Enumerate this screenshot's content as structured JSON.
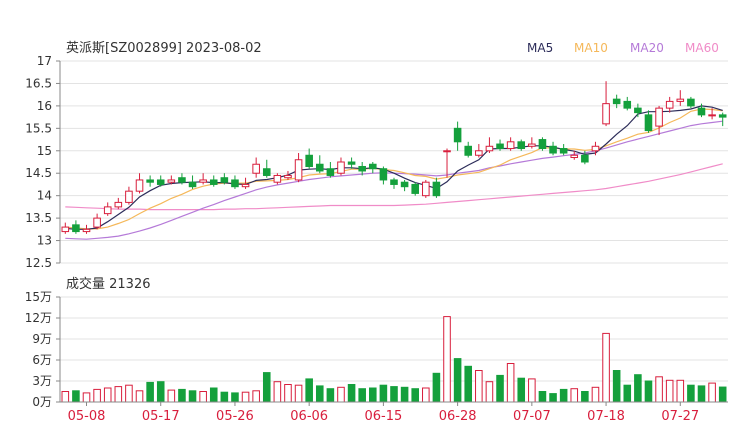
{
  "header": {
    "title": "英派斯[SZ002899] 2023-08-02",
    "legend": [
      {
        "name": "MA5",
        "color": "#2d2d5a"
      },
      {
        "name": "MA10",
        "color": "#f5b85a"
      },
      {
        "name": "MA20",
        "color": "#b57ad8"
      },
      {
        "name": "MA60",
        "color": "#f08cc8"
      }
    ]
  },
  "volume_label": "成交量 21326",
  "colors": {
    "up": "#d81e3c",
    "down": "#14a03c",
    "axis": "#333333",
    "grid": "#e3e3e3",
    "date": "#d81e3c"
  },
  "chart_data": [
    {
      "type": "candlestick",
      "title": "英派斯[SZ002899] 2023-08-02",
      "ylim": [
        12.5,
        17
      ],
      "yticks": [
        "17",
        "16.5",
        "16",
        "15.5",
        "15",
        "14.5",
        "14",
        "13.5",
        "13",
        "12.5"
      ],
      "dates": [
        "05-04",
        "05-05",
        "05-08",
        "05-09",
        "05-10",
        "05-11",
        "05-12",
        "05-15",
        "05-16",
        "05-17",
        "05-18",
        "05-19",
        "05-22",
        "05-23",
        "05-24",
        "05-25",
        "05-26",
        "05-29",
        "05-30",
        "05-31",
        "06-01",
        "06-02",
        "06-05",
        "06-06",
        "06-07",
        "06-08",
        "06-09",
        "06-12",
        "06-13",
        "06-14",
        "06-15",
        "06-16",
        "06-19",
        "06-20",
        "06-21",
        "06-26",
        "06-27",
        "06-28",
        "06-29",
        "06-30",
        "07-03",
        "07-04",
        "07-05",
        "07-06",
        "07-07",
        "07-10",
        "07-11",
        "07-12",
        "07-13",
        "07-14",
        "07-17",
        "07-18",
        "07-19",
        "07-20",
        "07-21",
        "07-24",
        "07-25",
        "07-26",
        "07-27",
        "07-28",
        "07-31",
        "08-01",
        "08-02"
      ],
      "xtick_labels": [
        "05-08",
        "05-17",
        "05-26",
        "06-06",
        "06-15",
        "06-28",
        "07-07",
        "07-18",
        "07-27"
      ],
      "open": [
        13.2,
        13.35,
        13.2,
        13.3,
        13.6,
        13.75,
        13.85,
        14.1,
        14.35,
        14.35,
        14.3,
        14.4,
        14.3,
        14.3,
        14.35,
        14.4,
        14.35,
        14.2,
        14.5,
        14.6,
        14.3,
        14.4,
        14.35,
        14.9,
        14.7,
        14.6,
        14.5,
        14.75,
        14.65,
        14.7,
        14.6,
        14.35,
        14.3,
        14.25,
        14.0,
        14.3,
        15.0,
        15.5,
        15.1,
        14.9,
        15.0,
        15.15,
        15.05,
        15.2,
        15.1,
        15.25,
        15.1,
        15.05,
        14.85,
        14.9,
        15.0,
        15.6,
        16.15,
        16.1,
        15.95,
        15.8,
        15.55,
        15.95,
        16.1,
        16.15,
        15.95,
        15.8,
        15.8
      ],
      "close": [
        13.3,
        13.2,
        13.25,
        13.5,
        13.75,
        13.85,
        14.1,
        14.35,
        14.3,
        14.25,
        14.35,
        14.3,
        14.2,
        14.35,
        14.25,
        14.3,
        14.2,
        14.25,
        14.7,
        14.45,
        14.45,
        14.45,
        14.8,
        14.65,
        14.55,
        14.45,
        14.75,
        14.7,
        14.55,
        14.6,
        14.35,
        14.25,
        14.2,
        14.05,
        14.3,
        14.0,
        15.0,
        15.2,
        14.9,
        15.0,
        15.1,
        15.05,
        15.2,
        15.05,
        15.15,
        15.05,
        14.95,
        14.95,
        14.9,
        14.75,
        15.1,
        16.05,
        16.05,
        15.95,
        15.85,
        15.45,
        15.95,
        16.1,
        16.15,
        16.0,
        15.8,
        15.8,
        15.75
      ],
      "high": [
        13.4,
        13.45,
        13.35,
        13.6,
        13.85,
        13.95,
        14.2,
        14.5,
        14.45,
        14.45,
        14.45,
        14.5,
        14.45,
        14.5,
        14.45,
        14.5,
        14.45,
        14.4,
        14.85,
        14.8,
        14.5,
        14.55,
        14.95,
        15.05,
        14.9,
        14.75,
        14.85,
        14.85,
        14.75,
        14.75,
        14.65,
        14.4,
        14.35,
        14.3,
        14.35,
        14.4,
        15.05,
        15.65,
        15.2,
        15.15,
        15.3,
        15.25,
        15.3,
        15.25,
        15.3,
        15.3,
        15.2,
        15.15,
        15.0,
        15.0,
        15.2,
        16.55,
        16.25,
        16.2,
        16.05,
        15.9,
        16.0,
        16.2,
        16.35,
        16.2,
        16.05,
        15.95,
        15.85
      ],
      "low": [
        13.15,
        13.15,
        13.15,
        13.25,
        13.55,
        13.7,
        13.8,
        14.05,
        14.2,
        14.2,
        14.25,
        14.25,
        14.15,
        14.25,
        14.2,
        14.25,
        14.15,
        14.15,
        14.4,
        14.4,
        14.25,
        14.35,
        14.3,
        14.6,
        14.5,
        14.4,
        14.45,
        14.6,
        14.45,
        14.5,
        14.25,
        14.15,
        14.1,
        14.0,
        13.95,
        13.95,
        14.4,
        15.0,
        14.85,
        14.85,
        14.95,
        15.0,
        15.0,
        15.0,
        15.05,
        15.0,
        14.9,
        14.9,
        14.8,
        14.7,
        14.9,
        15.55,
        15.95,
        15.9,
        15.75,
        15.4,
        15.35,
        15.85,
        16.0,
        15.95,
        15.75,
        15.7,
        15.55
      ],
      "volume_unit": "万",
      "volume_yticks": [
        "15万",
        "12万",
        "9万",
        "6万",
        "3万",
        "0万"
      ],
      "volume_ylim": [
        0,
        150000
      ],
      "volume": [
        15000,
        16000,
        13000,
        18000,
        20000,
        22000,
        24000,
        16000,
        28000,
        29000,
        17000,
        18000,
        16000,
        15000,
        20000,
        14000,
        13000,
        14000,
        16000,
        42000,
        29000,
        25000,
        24000,
        33000,
        23000,
        19000,
        21000,
        25000,
        19000,
        20000,
        24000,
        22000,
        21000,
        19000,
        20000,
        41000,
        122000,
        62000,
        51000,
        45000,
        29000,
        38000,
        55000,
        34000,
        33000,
        15000,
        12000,
        18000,
        19000,
        15000,
        21000,
        98000,
        45000,
        24000,
        39000,
        30000,
        36000,
        31000,
        31000,
        24000,
        23000,
        27000,
        21326
      ],
      "ma5": [
        13.27,
        13.25,
        13.25,
        13.28,
        13.42,
        13.58,
        13.74,
        13.97,
        14.11,
        14.23,
        14.27,
        14.29,
        14.3,
        14.31,
        14.29,
        14.29,
        14.26,
        14.25,
        14.34,
        14.36,
        14.4,
        14.46,
        14.57,
        14.59,
        14.6,
        14.58,
        14.62,
        14.62,
        14.6,
        14.62,
        14.59,
        14.5,
        14.39,
        14.29,
        14.23,
        14.16,
        14.31,
        14.55,
        14.68,
        14.8,
        15.04,
        15.05,
        15.05,
        15.08,
        15.11,
        15.11,
        15.08,
        15.03,
        14.99,
        14.92,
        14.95,
        15.15,
        15.37,
        15.56,
        15.82,
        15.87,
        15.87,
        15.88,
        15.9,
        15.93,
        16.0,
        15.97,
        15.9
      ],
      "ma10": [
        13.3,
        13.28,
        13.26,
        13.26,
        13.3,
        13.38,
        13.47,
        13.6,
        13.72,
        13.82,
        13.94,
        14.03,
        14.14,
        14.21,
        14.26,
        14.28,
        14.28,
        14.28,
        14.32,
        14.33,
        14.34,
        14.36,
        14.4,
        14.46,
        14.48,
        14.49,
        14.54,
        14.59,
        14.59,
        14.61,
        14.58,
        14.56,
        14.51,
        14.45,
        14.43,
        14.37,
        14.41,
        14.46,
        14.49,
        14.52,
        14.6,
        14.68,
        14.8,
        14.88,
        14.96,
        15.07,
        15.06,
        15.04,
        15.04,
        15.01,
        15.03,
        15.11,
        15.2,
        15.28,
        15.37,
        15.41,
        15.51,
        15.63,
        15.73,
        15.88,
        15.93,
        15.92,
        15.89
      ],
      "ma20": [
        13.05,
        13.04,
        13.03,
        13.05,
        13.07,
        13.1,
        13.15,
        13.21,
        13.28,
        13.36,
        13.45,
        13.54,
        13.63,
        13.72,
        13.8,
        13.89,
        13.97,
        14.05,
        14.13,
        14.19,
        14.24,
        14.28,
        14.32,
        14.36,
        14.39,
        14.42,
        14.44,
        14.46,
        14.48,
        14.5,
        14.51,
        14.5,
        14.49,
        14.48,
        14.46,
        14.44,
        14.46,
        14.5,
        14.53,
        14.56,
        14.62,
        14.66,
        14.71,
        14.75,
        14.79,
        14.83,
        14.86,
        14.89,
        14.92,
        14.95,
        15.0,
        15.06,
        15.13,
        15.2,
        15.26,
        15.32,
        15.38,
        15.44,
        15.5,
        15.56,
        15.6,
        15.63,
        15.66
      ],
      "ma60": [
        13.75,
        13.74,
        13.73,
        13.72,
        13.71,
        13.7,
        13.7,
        13.7,
        13.69,
        13.69,
        13.69,
        13.69,
        13.69,
        13.69,
        13.69,
        13.7,
        13.7,
        13.71,
        13.71,
        13.72,
        13.73,
        13.74,
        13.75,
        13.76,
        13.77,
        13.78,
        13.78,
        13.78,
        13.78,
        13.78,
        13.78,
        13.78,
        13.79,
        13.8,
        13.81,
        13.83,
        13.85,
        13.87,
        13.89,
        13.91,
        13.93,
        13.95,
        13.97,
        13.99,
        14.01,
        14.03,
        14.05,
        14.07,
        14.09,
        14.11,
        14.13,
        14.16,
        14.2,
        14.24,
        14.28,
        14.32,
        14.37,
        14.42,
        14.47,
        14.53,
        14.59,
        14.65,
        14.71
      ]
    }
  ]
}
